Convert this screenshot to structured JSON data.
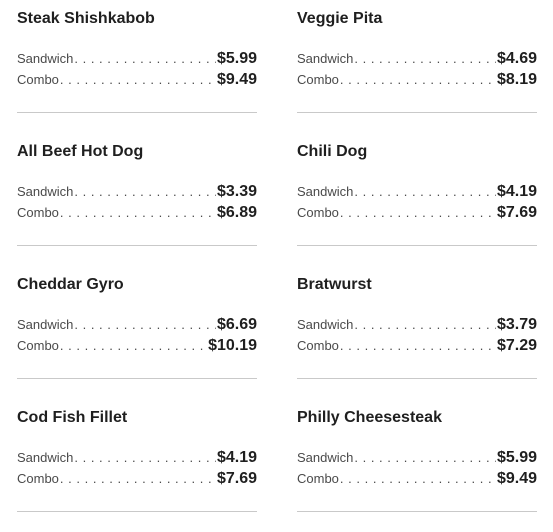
{
  "menu": {
    "items": [
      {
        "name": "Steak Shishkabob",
        "sandwich_label": "Sandwich",
        "sandwich_price": "$5.99",
        "combo_label": "Combo",
        "combo_price": "$9.49"
      },
      {
        "name": "Veggie Pita",
        "sandwich_label": "Sandwich",
        "sandwich_price": "$4.69",
        "combo_label": "Combo",
        "combo_price": "$8.19"
      },
      {
        "name": "All Beef Hot Dog",
        "sandwich_label": "Sandwich",
        "sandwich_price": "$3.39",
        "combo_label": "Combo",
        "combo_price": "$6.89"
      },
      {
        "name": "Chili Dog",
        "sandwich_label": "Sandwich",
        "sandwich_price": "$4.19",
        "combo_label": "Combo",
        "combo_price": "$7.69"
      },
      {
        "name": "Cheddar Gyro",
        "sandwich_label": "Sandwich",
        "sandwich_price": "$6.69",
        "combo_label": "Combo",
        "combo_price": "$10.19"
      },
      {
        "name": "Bratwurst",
        "sandwich_label": "Sandwich",
        "sandwich_price": "$3.79",
        "combo_label": "Combo",
        "combo_price": "$7.29"
      },
      {
        "name": "Cod Fish Fillet",
        "sandwich_label": "Sandwich",
        "sandwich_price": "$4.19",
        "combo_label": "Combo",
        "combo_price": "$7.69"
      },
      {
        "name": "Philly Cheesesteak",
        "sandwich_label": "Sandwich",
        "sandwich_price": "$5.99",
        "combo_label": "Combo",
        "combo_price": "$9.49"
      }
    ]
  },
  "colors": {
    "text": "#1f1f1f",
    "label": "#4a4a4a",
    "divider": "#c9c9c9",
    "background": "#ffffff"
  }
}
